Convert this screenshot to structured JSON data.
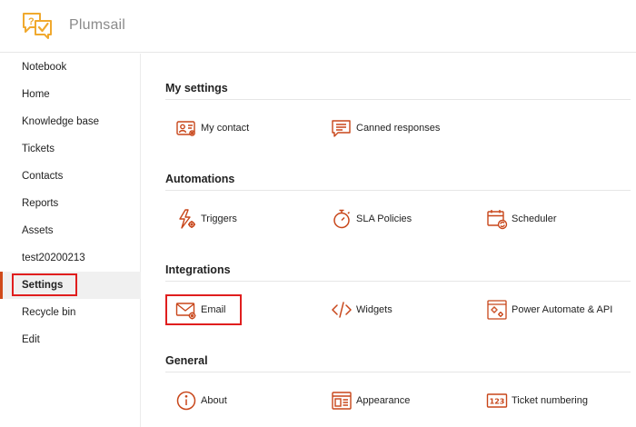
{
  "brand": {
    "name": "Plumsail",
    "logo_icon": "plumsail-logo-icon",
    "accent": "#d04a1a",
    "logo_color": "#f0a92e"
  },
  "sidebar": {
    "items": [
      {
        "id": "notebook",
        "label": "Notebook"
      },
      {
        "id": "home",
        "label": "Home"
      },
      {
        "id": "knowledge-base",
        "label": "Knowledge base"
      },
      {
        "id": "tickets",
        "label": "Tickets"
      },
      {
        "id": "contacts",
        "label": "Contacts"
      },
      {
        "id": "reports",
        "label": "Reports"
      },
      {
        "id": "assets",
        "label": "Assets"
      },
      {
        "id": "test20200213",
        "label": "test20200213"
      },
      {
        "id": "settings",
        "label": "Settings",
        "active": true
      },
      {
        "id": "recycle-bin",
        "label": "Recycle bin"
      },
      {
        "id": "edit",
        "label": "Edit"
      }
    ],
    "highlight_color": "#e01e1e"
  },
  "sections": [
    {
      "title": "My settings",
      "items": [
        {
          "label": "My contact",
          "icon": "contact-card-icon"
        },
        {
          "label": "Canned responses",
          "icon": "chat-lines-icon"
        }
      ]
    },
    {
      "title": "Automations",
      "items": [
        {
          "label": "Triggers",
          "icon": "lightning-gear-icon"
        },
        {
          "label": "SLA Policies",
          "icon": "stopwatch-icon"
        },
        {
          "label": "Scheduler",
          "icon": "calendar-refresh-icon"
        }
      ]
    },
    {
      "title": "Integrations",
      "items": [
        {
          "label": "Email",
          "icon": "envelope-gear-icon",
          "highlighted": true
        },
        {
          "label": "Widgets",
          "icon": "code-brackets-icon"
        },
        {
          "label": "Power Automate & API",
          "icon": "window-gears-icon"
        }
      ]
    },
    {
      "title": "General",
      "items": [
        {
          "label": "About",
          "icon": "info-circle-icon"
        },
        {
          "label": "Appearance",
          "icon": "layout-window-icon"
        },
        {
          "label": "Ticket numbering",
          "icon": "numbers-123-icon"
        }
      ]
    }
  ]
}
